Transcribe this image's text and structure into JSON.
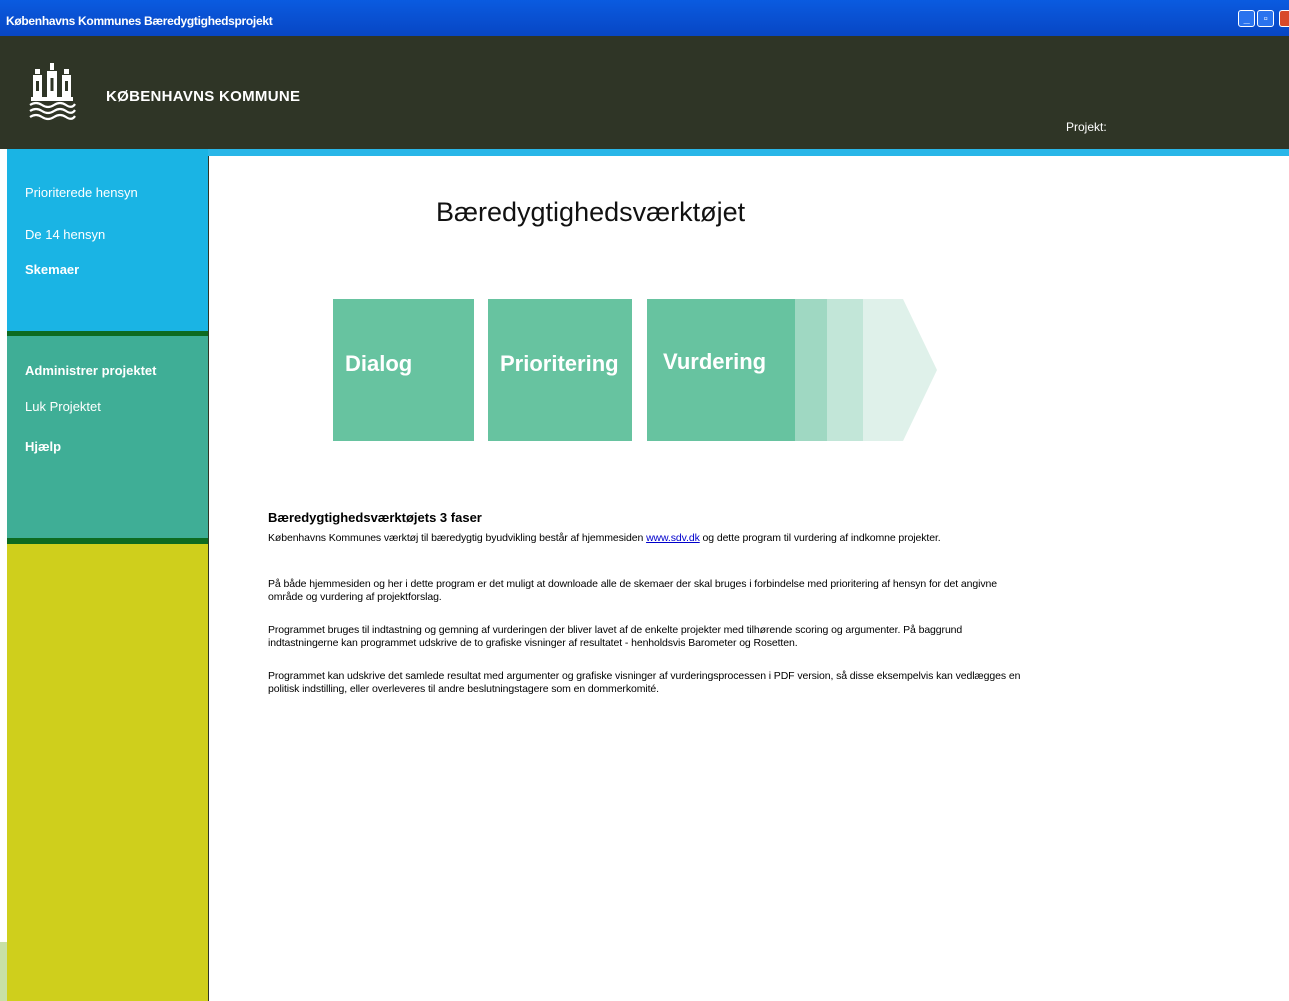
{
  "window": {
    "title": "Københavns Kommunes Bæredygtighedsprojekt"
  },
  "header": {
    "brand": "KØBENHAVNS KOMMUNE",
    "project_label": "Projekt:"
  },
  "sidebar": {
    "top_items": [
      {
        "label": "Prioriterede hensyn"
      },
      {
        "label": "De 14 hensyn"
      },
      {
        "label": "Skemaer"
      }
    ],
    "bottom_items": [
      {
        "label": "Administrer projektet"
      },
      {
        "label": "Luk Projektet"
      },
      {
        "label": "Hjælp"
      }
    ]
  },
  "main": {
    "title": "Bæredygtighedsværktøjet",
    "phases": [
      {
        "label": "Dialog"
      },
      {
        "label": "Prioritering"
      },
      {
        "label": "Vurdering"
      }
    ],
    "section_heading": "Bæredygtighedsværktøjets 3 faser",
    "paragraphs": {
      "p1_before": "Københavns Kommunes værktøj til bæredygtig byudvikling består af hjemmesiden ",
      "p1_link": "www.sdv.dk",
      "p1_after": " og dette program til vurdering af indkomne projekter.",
      "p2": "På både hjemmesiden og her i dette program er det muligt at downloade alle de skemaer der skal bruges i forbindelse med prioritering af hensyn for det angivne område og vurdering af projektforslag.",
      "p3": "Programmet bruges til indtastning og gemning af vurderingen der bliver lavet af de enkelte projekter med tilhørende scoring og argumenter. På baggrund indtastningerne kan programmet udskrive de to grafiske visninger af resultatet - henholdsvis Barometer og Rosetten.",
      "p4": "Programmet kan udskrive det samlede resultat med argumenter og grafiske visninger af vurderingsprocessen i PDF version, så disse eksempelvis kan vedlægges en politisk indstilling, eller overleveres til andre beslutningstagere som en dommerkomité."
    }
  },
  "colors": {
    "header_bg": "#2f3526",
    "cyan": "#1ab4e4",
    "teal": "#3fae96",
    "olive": "#cfcf1c",
    "phase_green": "#67c3a0"
  }
}
